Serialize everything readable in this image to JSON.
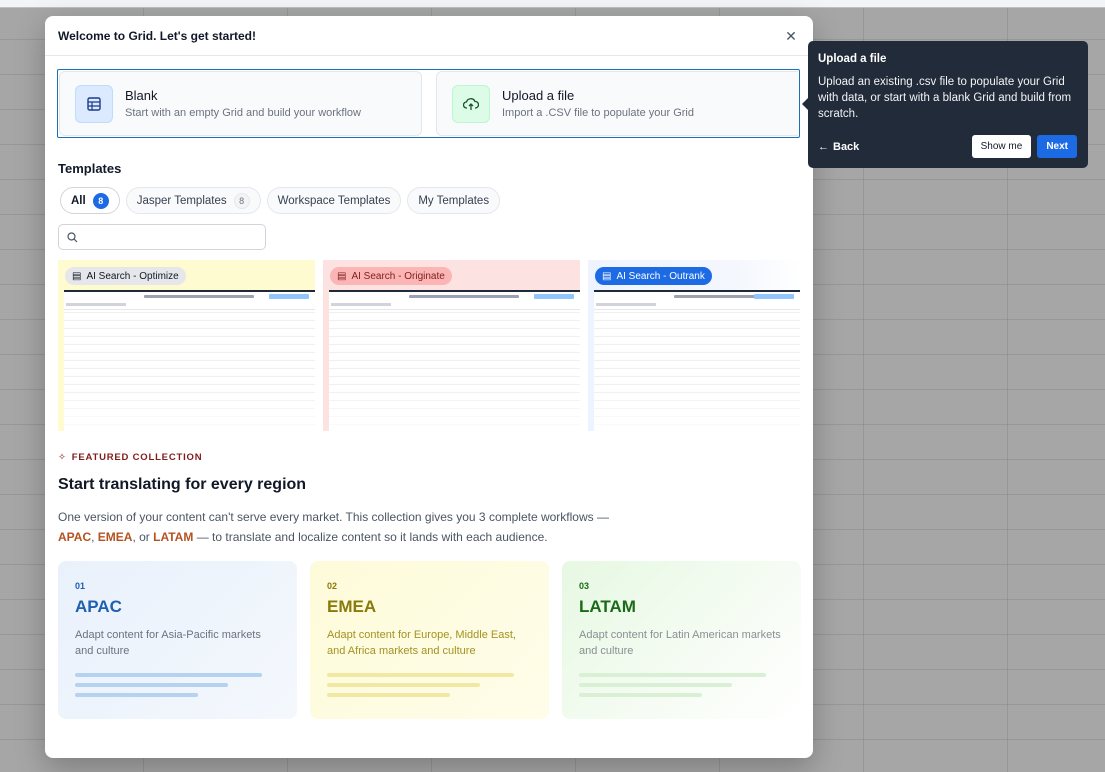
{
  "modal": {
    "title": "Welcome to Grid. Let's get started!",
    "close_icon": "close-icon"
  },
  "start_options": [
    {
      "title": "Blank",
      "subtitle": "Start with an empty Grid and build your workflow",
      "icon": "table-icon"
    },
    {
      "title": "Upload a file",
      "subtitle": "Import a .CSV file to populate your Grid",
      "icon": "upload-cloud-icon"
    }
  ],
  "templates_section": {
    "title": "Templates",
    "tabs": [
      {
        "label": "All",
        "count": "8"
      },
      {
        "label": "Jasper Templates",
        "count": "8"
      },
      {
        "label": "Workspace Templates"
      },
      {
        "label": "My Templates"
      }
    ],
    "search": {
      "placeholder": "",
      "value": ""
    },
    "cards": [
      {
        "label": "AI Search - Optimize",
        "color": "#fefbd1"
      },
      {
        "label": "AI Search - Originate",
        "color": "#fde2e2"
      },
      {
        "label": "AI Search - Outrank",
        "color": "#1d6ae5"
      }
    ]
  },
  "featured": {
    "label": "FEATURED COLLECTION",
    "title": "Start translating for every region",
    "desc_part1": "One version of your content can't serve every market. This collection gives you 3 complete workflows —",
    "region1": "APAC",
    "sep1": ", ",
    "region2": "EMEA",
    "sep2": ", or ",
    "region3": "LATAM",
    "desc_part2": " — to translate and localize content so it lands with each audience.",
    "regions": [
      {
        "num": "01",
        "name": "APAC",
        "desc": "Adapt content for Asia-Pacific markets and culture"
      },
      {
        "num": "02",
        "name": "EMEA",
        "desc": "Adapt content for Europe, Middle East, and Africa markets and culture"
      },
      {
        "num": "03",
        "name": "LATAM",
        "desc": "Adapt content for Latin American markets and culture"
      }
    ]
  },
  "tour": {
    "title": "Upload a file",
    "body": "Upload an existing .csv file to populate your Grid with data, or start with a blank Grid and build from scratch.",
    "back_label": "Back",
    "show_me_label": "Show me",
    "next_label": "Next"
  }
}
